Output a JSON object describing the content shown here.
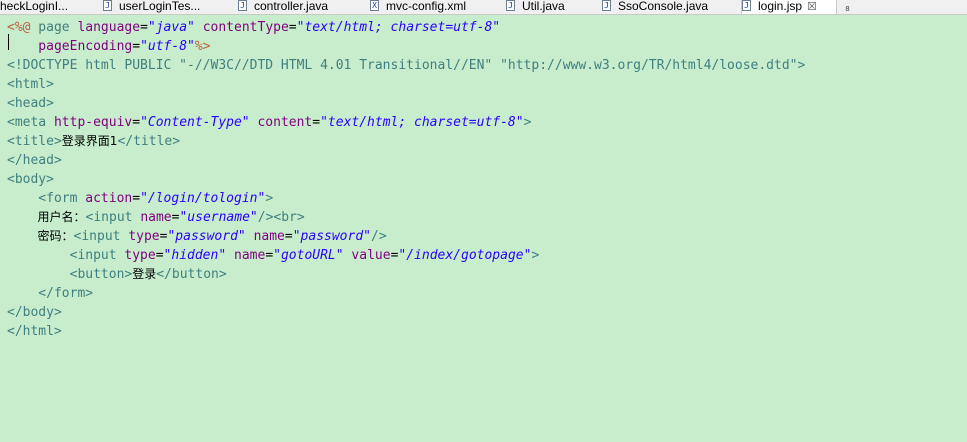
{
  "tabs": [
    {
      "label": "heckLoginI...",
      "icon": ""
    },
    {
      "label": "userLoginTes...",
      "icon": "J"
    },
    {
      "label": "controller.java",
      "icon": "J"
    },
    {
      "label": "mvc-config.xml",
      "icon": "X"
    },
    {
      "label": "Util.java",
      "icon": "J"
    },
    {
      "label": "SsoConsole.java",
      "icon": "J"
    },
    {
      "label": "login.jsp",
      "icon": "J",
      "close": "☒"
    },
    {
      "label": "₈",
      "icon": ""
    }
  ],
  "code": {
    "l1": {
      "a": "<%@",
      "b": " page ",
      "c": "language",
      "d": "=",
      "e": "\"java\"",
      "f": " contentType",
      "g": "=",
      "h": "\"text/html; charset=utf-8\""
    },
    "l2": {
      "a": "    pageEncoding",
      "b": "=",
      "c": "\"utf-8\"",
      "d": "%>"
    },
    "l3": {
      "a": "<!DOCTYPE html PUBLIC \"-//W3C//DTD HTML 4.01 Transitional//EN\" \"http://www.w3.org/TR/html4/loose.dtd\">"
    },
    "l4": {
      "a": "<html>"
    },
    "l5": {
      "a": "<head>"
    },
    "l6": {
      "a": "<meta",
      "b": " http-equiv",
      "c": "=",
      "d": "\"Content-Type\"",
      "e": " content",
      "f": "=",
      "g": "\"text/html; charset=utf-8\"",
      "h": ">"
    },
    "l7": {
      "a": "<title>",
      "b": "登录界面1",
      "c": "</title>"
    },
    "l8": {
      "a": "</head>"
    },
    "l9": {
      "a": "<body>"
    },
    "l10": {
      "a": "    <form",
      "b": " action",
      "c": "=",
      "d": "\"/login/tologin\"",
      "e": ">"
    },
    "l11": {
      "a": "        用户名：",
      "b": "<input",
      "c": " name",
      "d": "=",
      "e": "\"username\"",
      "f": "/><br>"
    },
    "l12": {
      "a": "        密码：",
      "b": "<input",
      "c": " type",
      "d": "=",
      "e": "\"password\"",
      "f": " name",
      "g": "=",
      "h": "\"password\"",
      "i": "/>"
    },
    "l13": {
      "a": "        <input",
      "b": " type",
      "c": "=",
      "d": "\"hidden\"",
      "e": " name",
      "f": "=",
      "g": "\"gotoURL\"",
      "h": " value",
      "i": "=",
      "j": "\"/index/gotopage\"",
      "k": ">"
    },
    "l14": {
      "a": "        <button>",
      "b": "登录",
      "c": "</button>"
    },
    "l15": {
      "a": "    </form>"
    },
    "l16": {
      "a": "</body>"
    },
    "l17": {
      "a": "</html>"
    }
  }
}
